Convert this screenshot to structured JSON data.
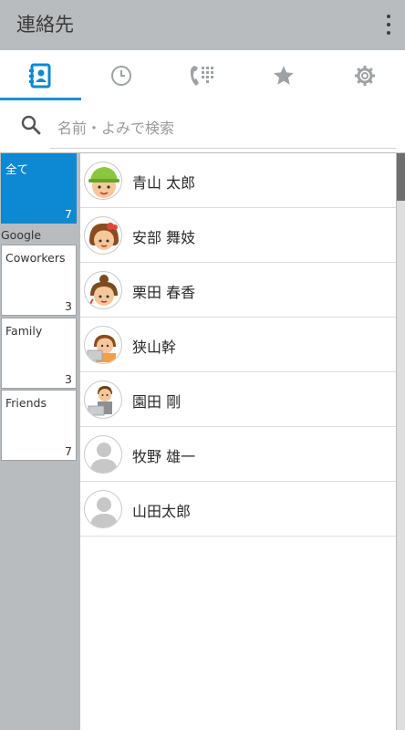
{
  "app": {
    "title": "連絡先"
  },
  "colors": {
    "accent": "#0d88d3",
    "appbar": "#b9bcbf",
    "tab_icon": "#9ea2a5"
  },
  "tabs": [
    {
      "icon": "contacts-book-icon",
      "active": true
    },
    {
      "icon": "clock-icon",
      "active": false
    },
    {
      "icon": "dialpad-icon",
      "active": false
    },
    {
      "icon": "star-icon",
      "active": false
    },
    {
      "icon": "gear-icon",
      "active": false
    }
  ],
  "search": {
    "placeholder": "名前・よみで検索"
  },
  "groups": {
    "all": {
      "label": "全て",
      "count": "7"
    },
    "account_header": "Google",
    "items": [
      {
        "label": "Coworkers",
        "count": "3"
      },
      {
        "label": "Family",
        "count": "3"
      },
      {
        "label": "Friends",
        "count": "7"
      }
    ]
  },
  "contacts": [
    {
      "name": "青山 太郎",
      "avatar": "boy-green-cap-avatar"
    },
    {
      "name": "安部 舞妓",
      "avatar": "girl-red-bow-avatar"
    },
    {
      "name": "栗田 春香",
      "avatar": "girl-bun-avatar"
    },
    {
      "name": "狭山幹",
      "avatar": "woman-laptop-avatar"
    },
    {
      "name": "園田 剛",
      "avatar": "man-laptop-avatar"
    },
    {
      "name": "牧野 雄一",
      "avatar": "default-person-avatar"
    },
    {
      "name": "山田太郎",
      "avatar": "default-person-avatar"
    }
  ]
}
